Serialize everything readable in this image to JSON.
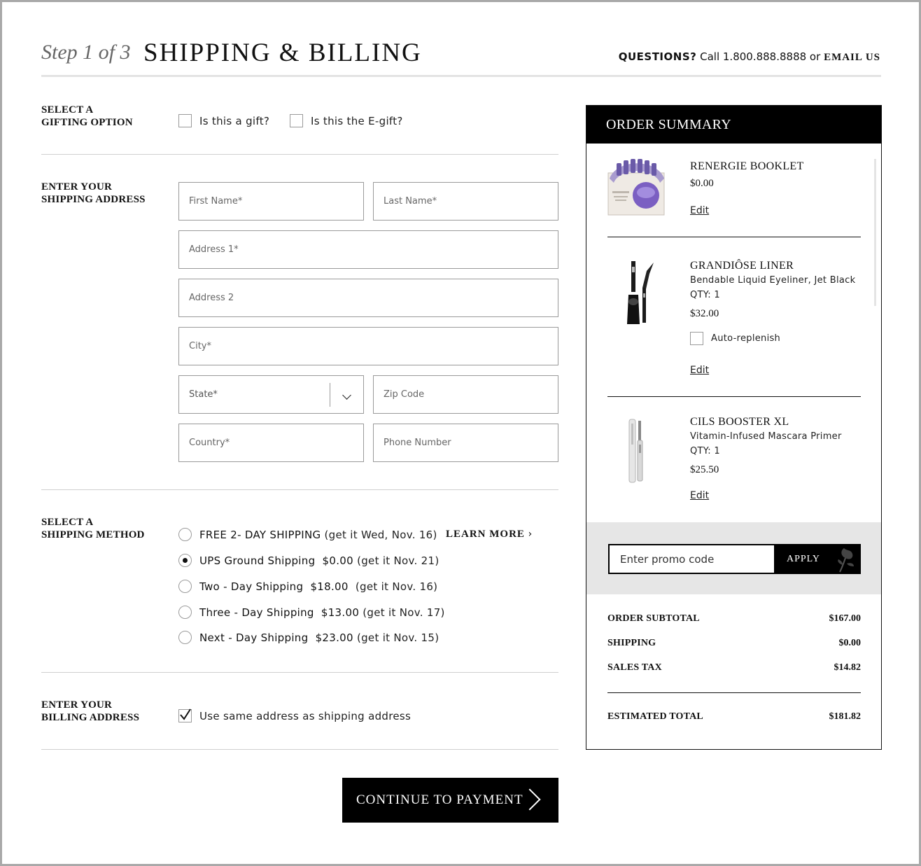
{
  "header": {
    "step": "Step 1 of 3",
    "title": "SHIPPING & BILLING",
    "questions_label": "QUESTIONS?",
    "call_text": "Call 1.800.888.8888 or",
    "email_label": "EMAIL US"
  },
  "gifting": {
    "label_line1": "SELECT A",
    "label_line2": "GIFTING OPTION",
    "gift_label": "Is this a gift?",
    "egift_label": "Is this the E-gift?"
  },
  "shipping_address": {
    "label_line1": "ENTER YOUR",
    "label_line2": "SHIPPING ADDRESS",
    "first_name": "First Name*",
    "last_name": "Last Name*",
    "address1": "Address 1*",
    "address2": "Address 2",
    "city": "City*",
    "state": "State*",
    "zip": "Zip Code",
    "country": "Country*",
    "phone": "Phone Number"
  },
  "shipping_method": {
    "label_line1": "SELECT A",
    "label_line2": "SHIPPING METHOD",
    "learn_more": "LEARN MORE",
    "options": [
      {
        "name": "FREE 2- DAY SHIPPING",
        "price": "",
        "eta": "(get it Wed, Nov. 16)",
        "selected": false
      },
      {
        "name": "UPS Ground Shipping",
        "price": "$0.00",
        "eta": "(get it Nov. 21)",
        "selected": true
      },
      {
        "name": "Two - Day Shipping",
        "price": "$18.00",
        "eta": "(get it Nov. 16)",
        "selected": false
      },
      {
        "name": "Three - Day Shipping",
        "price": "$13.00",
        "eta": "(get it Nov. 17)",
        "selected": false
      },
      {
        "name": "Next - Day Shipping",
        "price": "$23.00",
        "eta": "(get it Nov. 15)",
        "selected": false
      }
    ]
  },
  "billing": {
    "label_line1": "ENTER YOUR",
    "label_line2": "BILLING ADDRESS",
    "same_address_label": "Use same address as shipping address",
    "same_address_checked": true
  },
  "continue_label": "CONTINUE TO PAYMENT",
  "summary": {
    "title": "ORDER SUMMARY",
    "items": [
      {
        "name": "RENERGIE BOOKLET",
        "description": "",
        "qty": "",
        "price": "$0.00",
        "edit": "Edit"
      },
      {
        "name": "GRANDIÔSE LINER",
        "description": "Bendable Liquid Eyeliner, Jet Black",
        "qty": "QTY: 1",
        "price": "$32.00",
        "auto_replenish": "Auto-replenish",
        "edit": "Edit"
      },
      {
        "name": "CILS BOOSTER XL",
        "description": "Vitamin-Infused Mascara Primer",
        "qty": "QTY: 1",
        "price": "$25.50",
        "edit": "Edit"
      }
    ],
    "promo_placeholder": "Enter promo code",
    "apply_label": "APPLY",
    "subtotal_label": "ORDER SUBTOTAL",
    "subtotal": "$167.00",
    "shipping_label": "SHIPPING",
    "shipping": "$0.00",
    "tax_label": "SALES TAX",
    "tax": "$14.82",
    "total_label": "ESTIMATED TOTAL",
    "total": "$181.82"
  },
  "colors": {
    "accent": "#000000",
    "border": "#9a9a9a",
    "promo_band": "#e6e6e6"
  }
}
